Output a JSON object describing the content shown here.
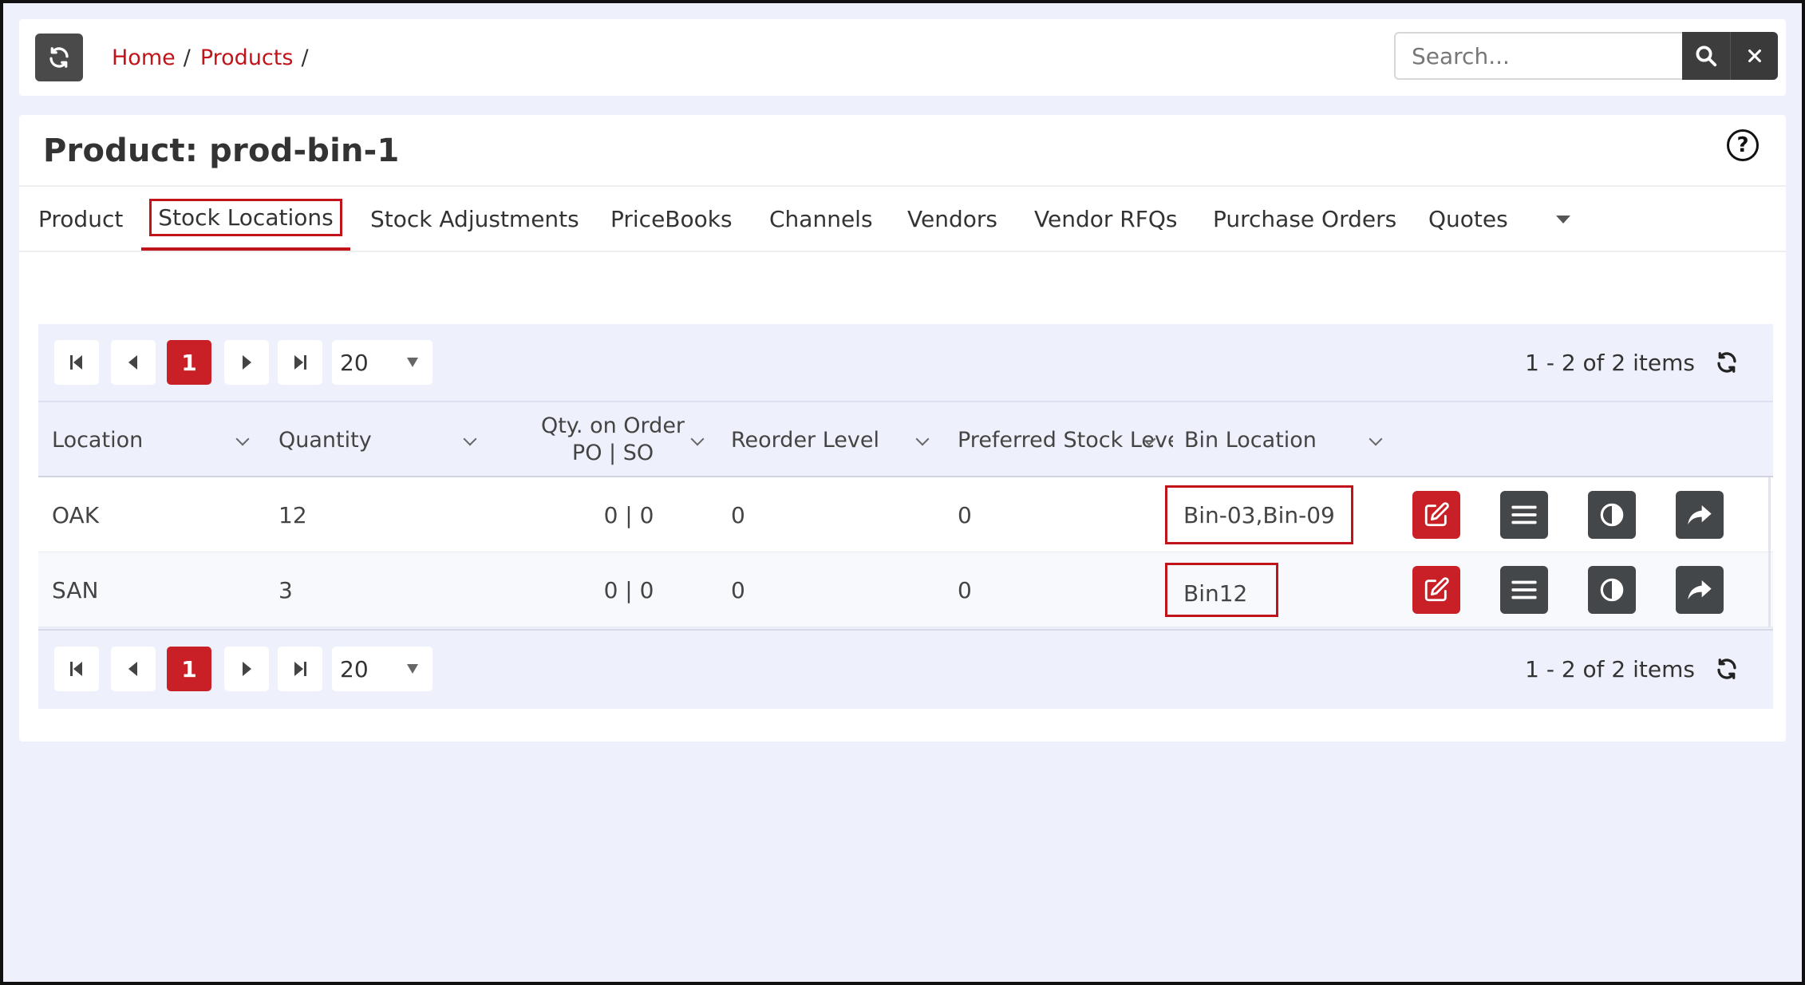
{
  "breadcrumb": {
    "home": "Home",
    "products": "Products",
    "separator": "/"
  },
  "search": {
    "placeholder": "Search..."
  },
  "product": {
    "title": "Product: prod-bin-1"
  },
  "tabs": [
    {
      "label": "Product"
    },
    {
      "label": "Stock Locations"
    },
    {
      "label": "Stock Adjustments"
    },
    {
      "label": "PriceBooks"
    },
    {
      "label": "Channels"
    },
    {
      "label": "Vendors"
    },
    {
      "label": "Vendor RFQs"
    },
    {
      "label": "Purchase Orders"
    },
    {
      "label": "Quotes"
    }
  ],
  "active_tab": "Stock Locations",
  "pager": {
    "current_page": "1",
    "page_size": "20",
    "info": "1 - 2 of 2 items"
  },
  "columns": {
    "location": "Location",
    "quantity": "Quantity",
    "qty_on_order_line1": "Qty. on Order",
    "qty_on_order_line2": "PO | SO",
    "reorder_level": "Reorder Level",
    "preferred_stock_level": "Preferred Stock Level",
    "bin_location": "Bin Location"
  },
  "rows": [
    {
      "location": "OAK",
      "quantity": "12",
      "qty_on_order": "0 | 0",
      "reorder_level": "0",
      "preferred_stock_level": "0",
      "bin_location": "Bin-03,Bin-09"
    },
    {
      "location": "SAN",
      "quantity": "3",
      "qty_on_order": "0 | 0",
      "reorder_level": "0",
      "preferred_stock_level": "0",
      "bin_location": "Bin12"
    }
  ],
  "row_actions": [
    "edit-icon",
    "menu-icon",
    "contrast-icon",
    "share-icon"
  ],
  "colors": {
    "accent": "#c0141a",
    "dark_button": "#444749",
    "background": "#eef1fb"
  }
}
